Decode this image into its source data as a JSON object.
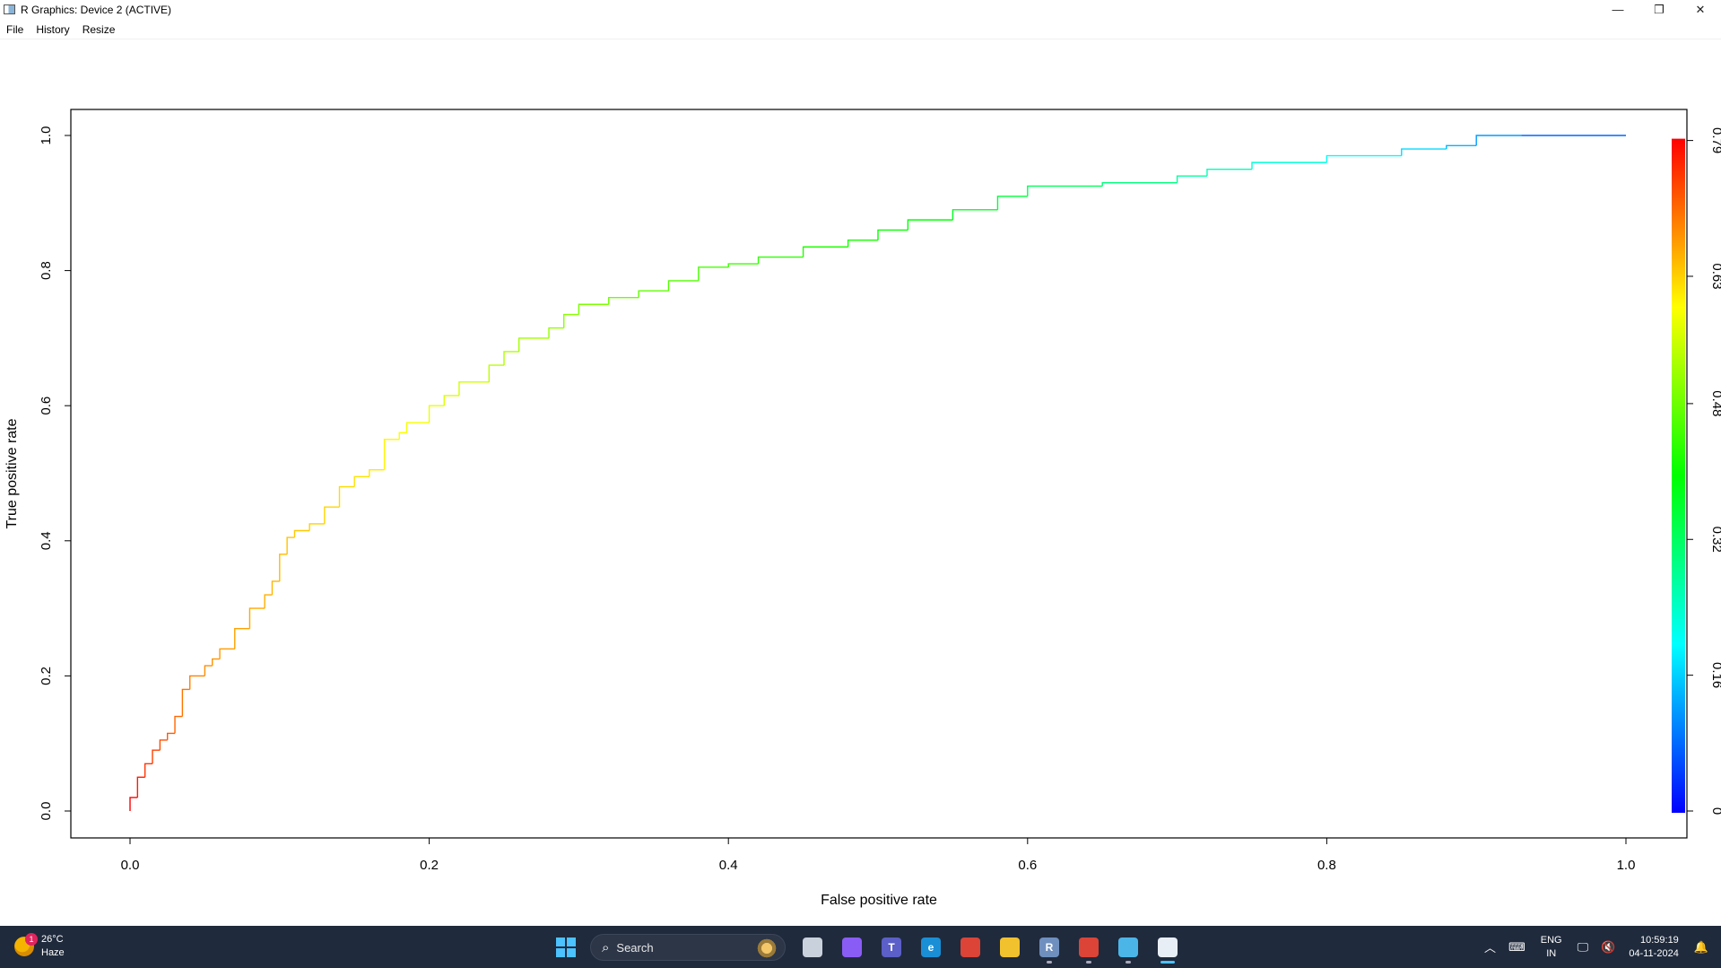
{
  "window": {
    "title": "R Graphics: Device 2 (ACTIVE)",
    "minimize_glyph": "—",
    "restore_glyph": "❐",
    "close_glyph": "✕"
  },
  "menu": {
    "items": [
      "File",
      "History",
      "Resize"
    ]
  },
  "chart_data": {
    "type": "line",
    "title": "",
    "xlabel": "False positive rate",
    "ylabel": "True positive rate",
    "xlim": [
      0.0,
      1.0
    ],
    "ylim": [
      0.0,
      1.0
    ],
    "x_ticks": [
      "0.0",
      "0.2",
      "0.4",
      "0.6",
      "0.8",
      "1.0"
    ],
    "y_ticks": [
      "0.0",
      "0.2",
      "0.4",
      "0.6",
      "0.8",
      "1.0"
    ],
    "colorbar": {
      "ticks": [
        "0",
        "0.16",
        "0.32",
        "0.48",
        "0.63",
        "0.79"
      ],
      "range": [
        0,
        0.79
      ],
      "colors": [
        "#0000ff",
        "#00ffff",
        "#00ff00",
        "#ffff00",
        "#ff0000"
      ]
    },
    "grid": false,
    "series": [
      {
        "x": [
          0.0,
          0.005,
          0.01,
          0.015,
          0.02,
          0.025,
          0.03,
          0.035,
          0.04,
          0.05,
          0.055,
          0.06,
          0.07,
          0.08,
          0.09,
          0.095,
          0.1,
          0.105,
          0.11,
          0.12,
          0.13,
          0.14,
          0.15,
          0.16,
          0.17,
          0.18,
          0.185,
          0.2,
          0.21,
          0.22,
          0.24,
          0.25,
          0.26,
          0.28,
          0.29,
          0.3,
          0.32,
          0.34,
          0.36,
          0.38,
          0.4,
          0.42,
          0.45,
          0.48,
          0.5,
          0.52,
          0.55,
          0.58,
          0.6,
          0.65,
          0.7,
          0.72,
          0.75,
          0.8,
          0.85,
          0.88,
          0.9,
          0.93,
          1.0
        ],
        "y": [
          0.0,
          0.02,
          0.05,
          0.07,
          0.09,
          0.105,
          0.115,
          0.14,
          0.18,
          0.2,
          0.215,
          0.225,
          0.24,
          0.27,
          0.3,
          0.32,
          0.34,
          0.38,
          0.405,
          0.415,
          0.425,
          0.45,
          0.48,
          0.495,
          0.505,
          0.55,
          0.56,
          0.575,
          0.6,
          0.615,
          0.635,
          0.66,
          0.68,
          0.7,
          0.715,
          0.735,
          0.75,
          0.76,
          0.77,
          0.785,
          0.805,
          0.81,
          0.82,
          0.835,
          0.845,
          0.86,
          0.875,
          0.89,
          0.91,
          0.925,
          0.93,
          0.94,
          0.95,
          0.96,
          0.97,
          0.98,
          0.985,
          1.0,
          1.0
        ],
        "threshold": [
          0.79,
          0.77,
          0.75,
          0.74,
          0.73,
          0.72,
          0.71,
          0.7,
          0.69,
          0.68,
          0.675,
          0.67,
          0.665,
          0.66,
          0.655,
          0.65,
          0.645,
          0.64,
          0.635,
          0.63,
          0.625,
          0.62,
          0.615,
          0.61,
          0.6,
          0.59,
          0.585,
          0.575,
          0.565,
          0.555,
          0.54,
          0.53,
          0.52,
          0.51,
          0.5,
          0.49,
          0.48,
          0.47,
          0.46,
          0.45,
          0.44,
          0.43,
          0.42,
          0.41,
          0.4,
          0.39,
          0.37,
          0.35,
          0.33,
          0.3,
          0.27,
          0.25,
          0.23,
          0.2,
          0.17,
          0.14,
          0.12,
          0.08,
          0.0
        ]
      }
    ]
  },
  "taskbar": {
    "weather_temp": "26°C",
    "weather_desc": "Haze",
    "weather_badge": "1",
    "search_label": "Search",
    "lang_top": "ENG",
    "lang_bottom": "IN",
    "time": "10:59:19",
    "date": "04-11-2024",
    "apps": [
      {
        "name": "task-view-icon",
        "color": "#c9d1dc",
        "glyph": "",
        "dot": ""
      },
      {
        "name": "copilot-icon",
        "color": "#8a5cf6",
        "glyph": "",
        "dot": ""
      },
      {
        "name": "teams-icon",
        "color": "#5b5fc7",
        "glyph": "T",
        "dot": ""
      },
      {
        "name": "edge-icon",
        "color": "#1a8fd6",
        "glyph": "e",
        "dot": ""
      },
      {
        "name": "chrome-icon",
        "color": "#db4437",
        "glyph": "",
        "dot": ""
      },
      {
        "name": "file-explorer-icon",
        "color": "#f2c12e",
        "glyph": "",
        "dot": ""
      },
      {
        "name": "r-app-icon",
        "color": "#6f8fbf",
        "glyph": "R",
        "dot": "dot"
      },
      {
        "name": "chrome-2-icon",
        "color": "#db4437",
        "glyph": "",
        "dot": "dot"
      },
      {
        "name": "notepad-icon",
        "color": "#4cb5e8",
        "glyph": "",
        "dot": "dot"
      },
      {
        "name": "r-graphics-icon",
        "color": "#e8eef5",
        "glyph": "",
        "dot": "active"
      }
    ]
  }
}
